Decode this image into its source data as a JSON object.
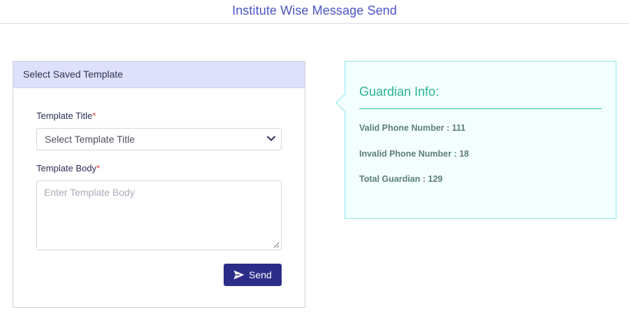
{
  "header": {
    "title": "Institute Wise Message Send"
  },
  "template_panel": {
    "heading": "Select Saved Template",
    "title_field": {
      "label": "Template Title",
      "required_mark": "*",
      "value": "Select Template Title"
    },
    "body_field": {
      "label": "Template Body",
      "required_mark": "*",
      "placeholder": "Enter Template Body"
    },
    "send_button": {
      "label": "Send",
      "icon": "send-icon"
    }
  },
  "guardian_info": {
    "title": "Guardian Info:",
    "valid_phone": "Valid Phone Number : 111",
    "invalid_phone": "Invalid Phone Number : 18",
    "total_guardian": "Total Guardian : 129"
  },
  "colors": {
    "title": "#4b55c7",
    "panel_heading_bg": "#dfe0fc",
    "button_bg": "#2c2c89",
    "info_card_bg": "#f3fefe",
    "info_card_border": "#8ee9ef",
    "info_title": "#2bb394"
  }
}
